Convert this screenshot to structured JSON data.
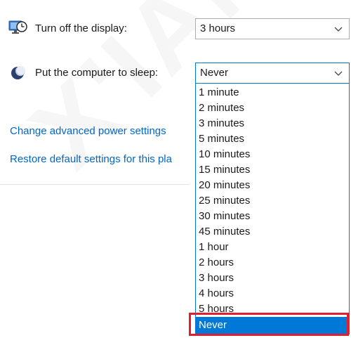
{
  "settings": {
    "display": {
      "label": "Turn off the display:",
      "value": "3 hours"
    },
    "sleep": {
      "label": "Put the computer to sleep:",
      "value": "Never"
    }
  },
  "links": {
    "advanced": "Change advanced power settings",
    "restore": "Restore default settings for this pla"
  },
  "dropdown": {
    "options": [
      "1 minute",
      "2 minutes",
      "3 minutes",
      "5 minutes",
      "10 minutes",
      "15 minutes",
      "20 minutes",
      "25 minutes",
      "30 minutes",
      "45 minutes",
      "1 hour",
      "2 hours",
      "3 hours",
      "4 hours",
      "5 hours",
      "Never"
    ],
    "selected_index": 15
  },
  "colors": {
    "accent": "#0078d7",
    "link": "#0066cc",
    "highlight_border": "#e02030"
  },
  "icons": {
    "display": "monitor-clock-icon",
    "sleep": "moon-icon",
    "chevron": "chevron-down-icon"
  }
}
